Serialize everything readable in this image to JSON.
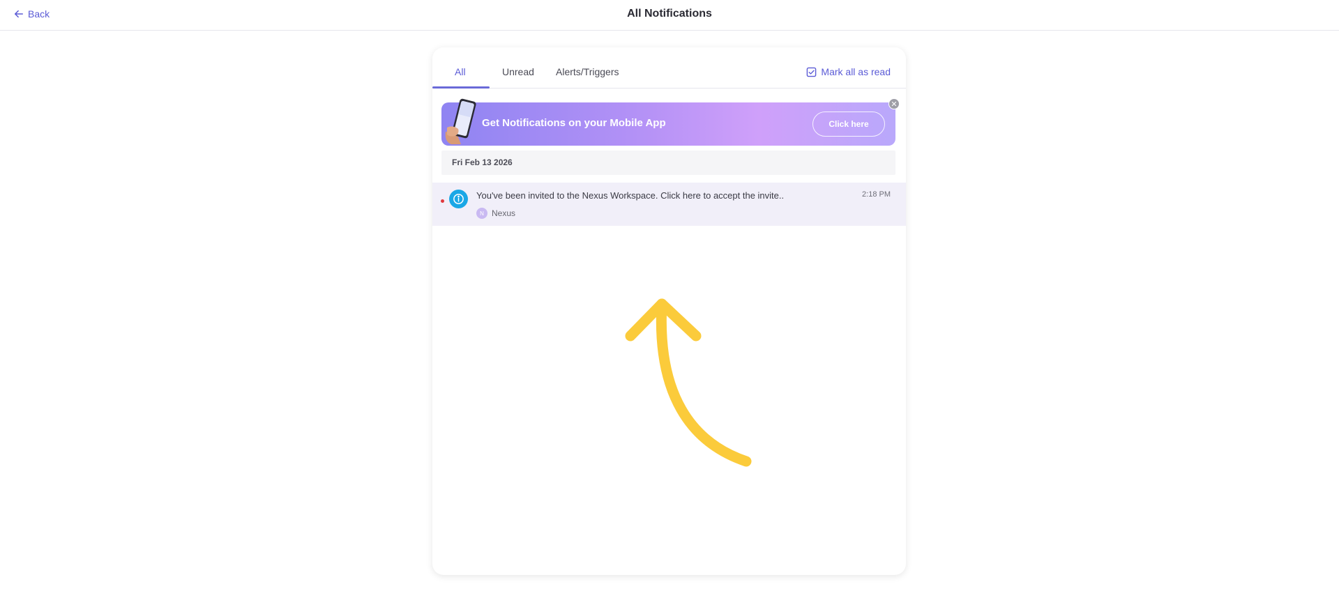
{
  "header": {
    "back_label": "Back",
    "title": "All Notifications"
  },
  "tabs": [
    {
      "label": "All",
      "active": true
    },
    {
      "label": "Unread",
      "active": false
    },
    {
      "label": "Alerts/Triggers",
      "active": false
    }
  ],
  "mark_all_read_label": "Mark all as read",
  "banner": {
    "text": "Get Notifications on your Mobile App",
    "button_label": "Click here"
  },
  "date_group": "Fri Feb 13 2026",
  "notifications": [
    {
      "text": "You've been invited to the Nexus Workspace. Click here to accept the invite..",
      "time": "2:18 PM",
      "source": "Nexus",
      "source_initial": "N",
      "unread": true,
      "icon": "info-icon"
    }
  ],
  "colors": {
    "accent": "#5b5bd6",
    "info_icon": "#1aa7e6",
    "unread_dot": "#e0393e",
    "annotation_arrow": "#fbcb3b"
  }
}
